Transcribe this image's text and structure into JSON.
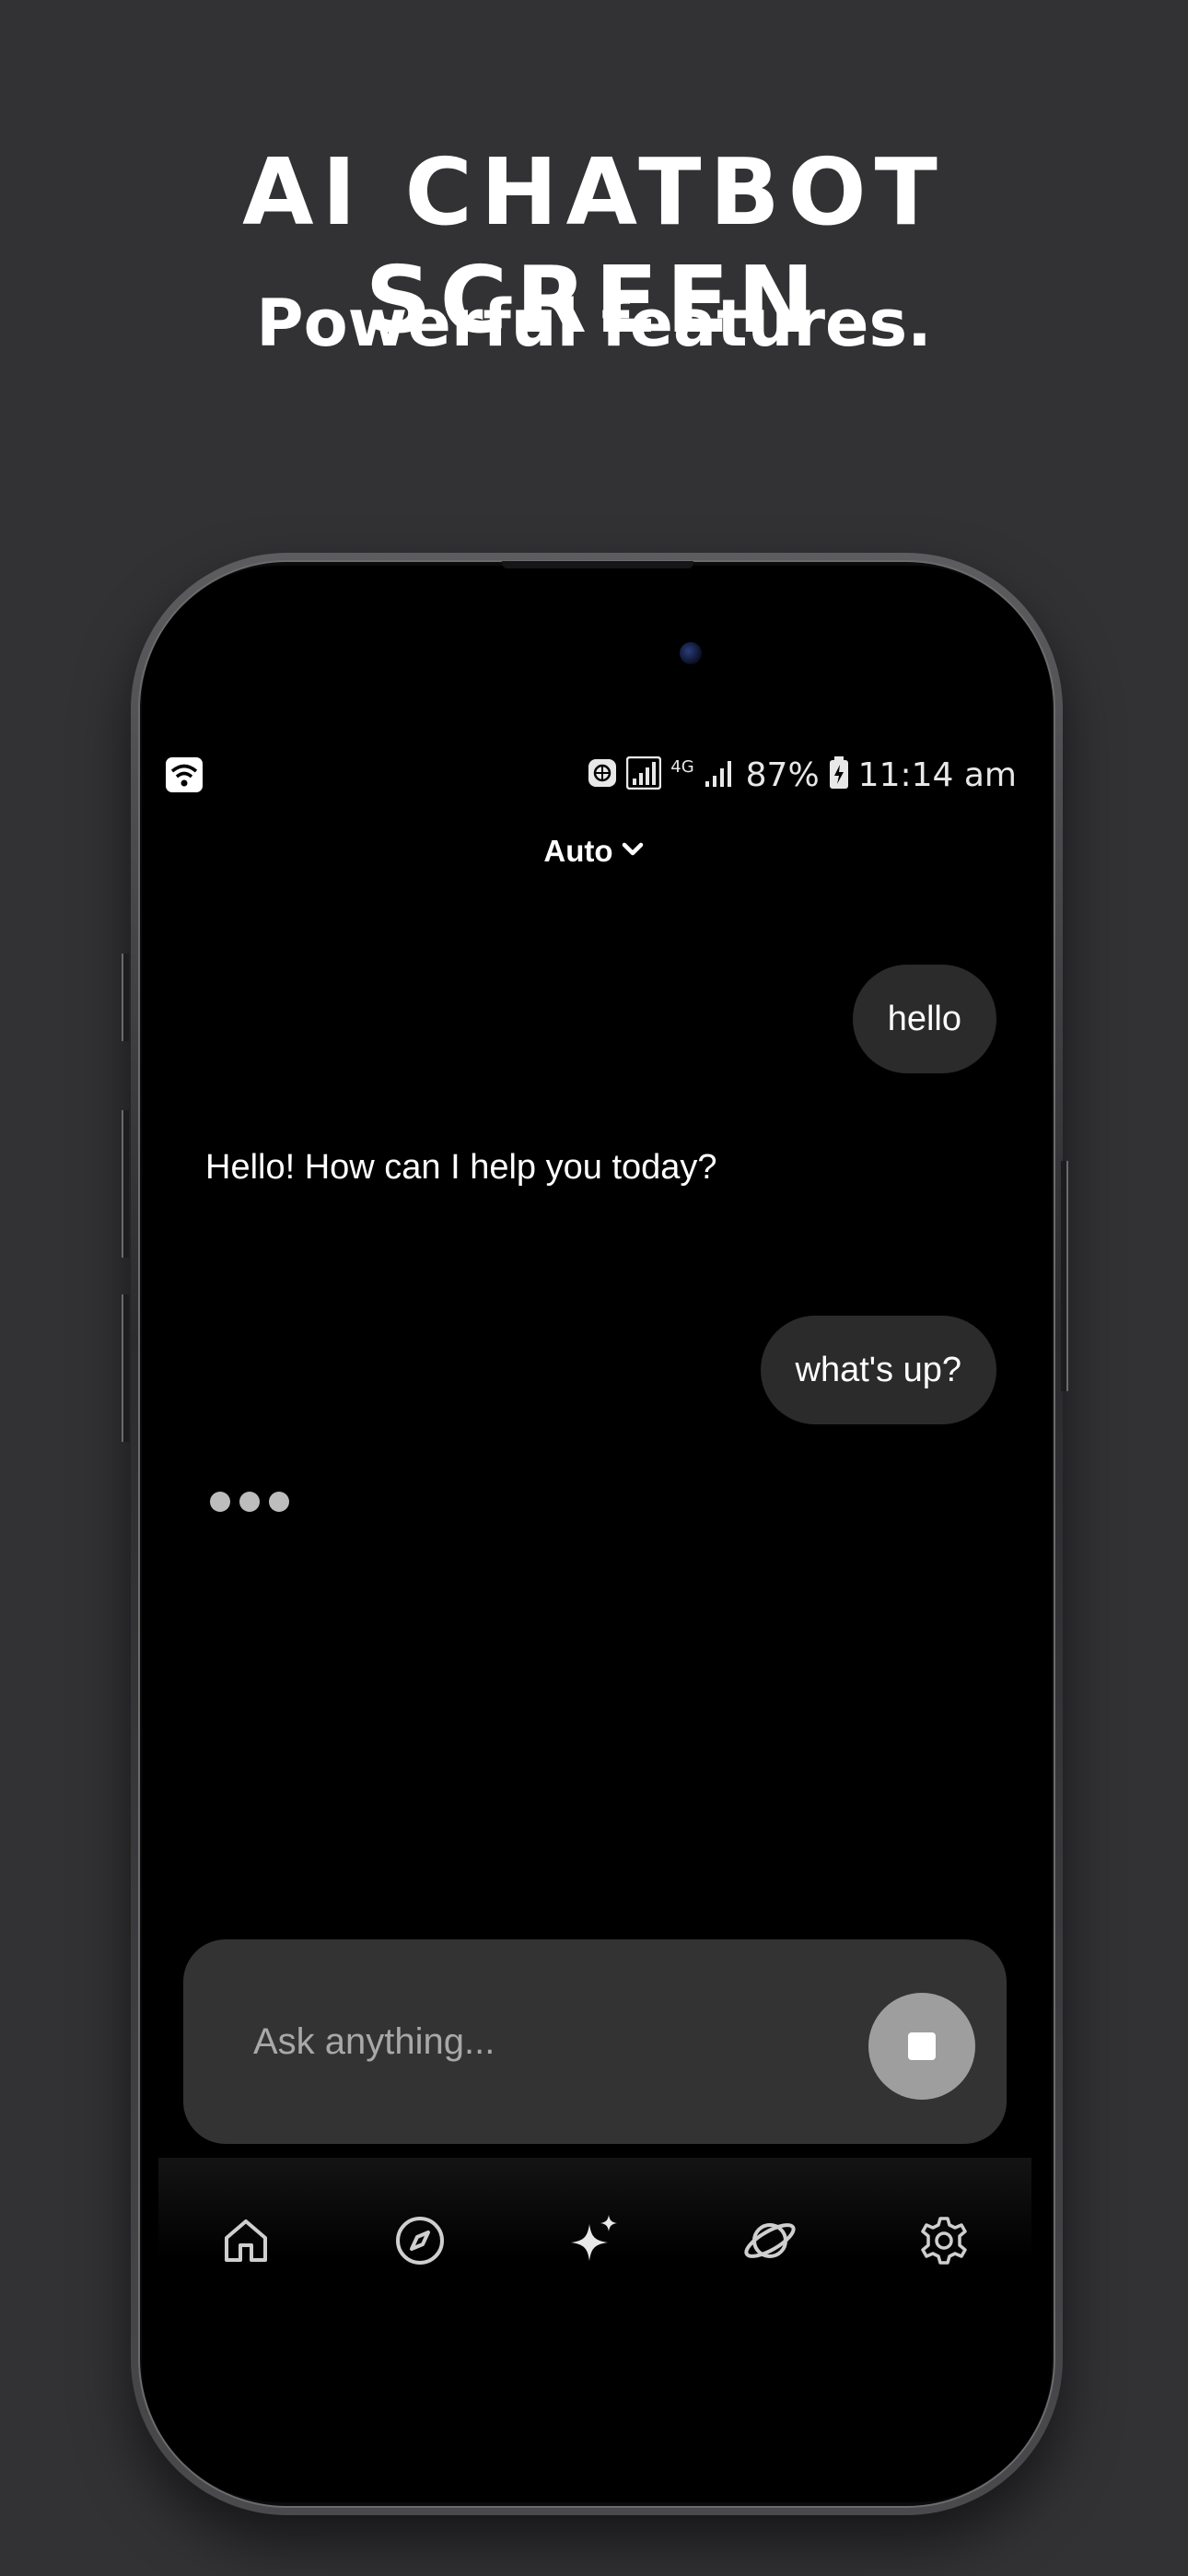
{
  "headline": "AI CHATBOT SCREEN",
  "subheadline": "Powerful features.",
  "status_bar": {
    "battery": "87%",
    "time": "11:14 am",
    "network_type": "4G"
  },
  "model_selector": {
    "label": "Auto",
    "icon": "chevron-down-icon"
  },
  "conversation": [
    {
      "role": "user",
      "text": "hello"
    },
    {
      "role": "assistant",
      "text": "Hello! How can I help you today?"
    },
    {
      "role": "user",
      "text": "what's up?"
    }
  ],
  "assistant_typing": true,
  "input": {
    "placeholder": "Ask anything...",
    "value": ""
  },
  "stop_button_icon": "stop-icon",
  "bottom_nav": [
    {
      "name": "home",
      "icon": "home-icon"
    },
    {
      "name": "explore",
      "icon": "compass-icon"
    },
    {
      "name": "ai",
      "icon": "sparkle-icon"
    },
    {
      "name": "discover",
      "icon": "planet-icon"
    },
    {
      "name": "settings",
      "icon": "gear-icon"
    }
  ],
  "colors": {
    "page_background": "#323235",
    "screen_background": "#000000",
    "bubble": "#2b2b2b",
    "input_background": "#333333",
    "stop_button": "#9e9e9e"
  }
}
